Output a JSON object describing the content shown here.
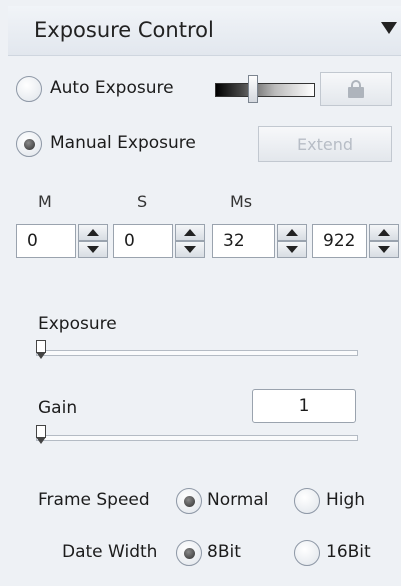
{
  "header": {
    "title": "Exposure Control"
  },
  "exposure_mode": {
    "auto_label": "Auto Exposure",
    "manual_label": "Manual Exposure",
    "selected": "manual",
    "extend_label": "Extend"
  },
  "time": {
    "labels": {
      "m": "M",
      "s": "S",
      "ms": "Ms"
    },
    "values": {
      "m": "0",
      "s": "0",
      "ms": "32",
      "us": "922"
    }
  },
  "exposure": {
    "label": "Exposure"
  },
  "gain": {
    "label": "Gain",
    "value": "1"
  },
  "frame_speed": {
    "label": "Frame Speed",
    "normal_label": "Normal",
    "high_label": "High",
    "selected": "normal"
  },
  "data_width": {
    "label": "Date Width",
    "bit8_label": "8Bit",
    "bit16_label": "16Bit",
    "selected": "8bit"
  }
}
